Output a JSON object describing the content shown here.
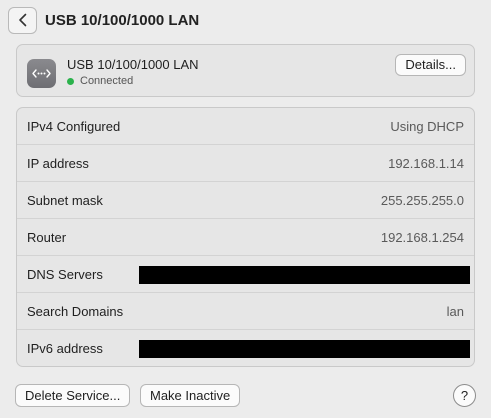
{
  "header": {
    "title": "USB 10/100/1000 LAN",
    "back_icon": "chevron-left-icon"
  },
  "service": {
    "icon": "ethernet-icon",
    "name": "USB 10/100/1000 LAN",
    "status": "Connected",
    "status_color": "#2bb24c",
    "details_label": "Details..."
  },
  "rows": [
    {
      "label": "IPv4 Configured",
      "value": "Using DHCP"
    },
    {
      "label": "IP address",
      "value": "192.168.1.14"
    },
    {
      "label": "Subnet mask",
      "value": "255.255.255.0"
    },
    {
      "label": "Router",
      "value": "192.168.1.254"
    },
    {
      "label": "DNS Servers",
      "value": ""
    },
    {
      "label": "Search Domains",
      "value": "lan"
    },
    {
      "label": "IPv6 address",
      "value": ""
    }
  ],
  "footer": {
    "delete_label": "Delete Service...",
    "inactive_label": "Make Inactive",
    "help_label": "?"
  }
}
